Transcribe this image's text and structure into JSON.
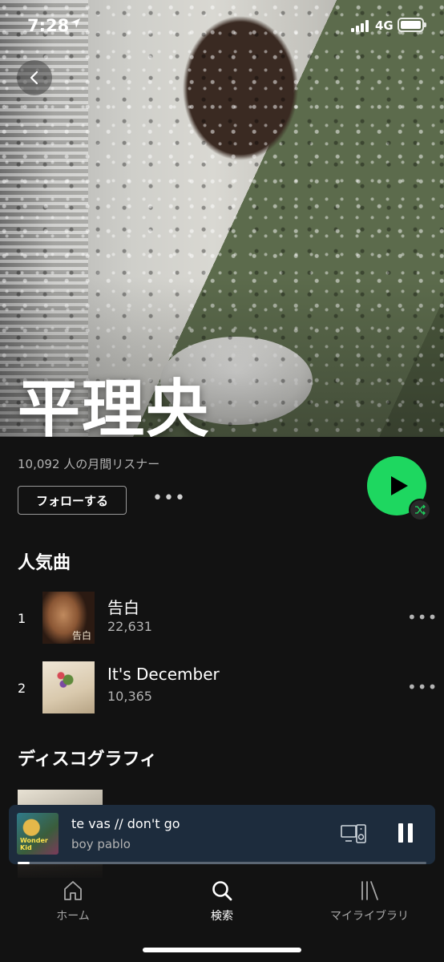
{
  "status_bar": {
    "time": "7:28",
    "network": "4G"
  },
  "artist": {
    "name": "平理央",
    "monthly_listeners": "10,092 人の月間リスナー",
    "follow_label": "フォローする"
  },
  "popular": {
    "title": "人気曲",
    "tracks": [
      {
        "rank": "1",
        "title": "告白",
        "plays": "22,631",
        "art_text": "告白"
      },
      {
        "rank": "2",
        "title": "It's December",
        "plays": "10,365"
      }
    ]
  },
  "discography": {
    "title": "ディスコグラフィ"
  },
  "now_playing": {
    "title": "te vas // don't go",
    "artist": "boy pablo",
    "progress": 0.03
  },
  "nav": {
    "home": "ホーム",
    "search": "検索",
    "library": "マイライブラリ",
    "active": "search"
  },
  "colors": {
    "accent": "#1ed760",
    "mini_player_bg": "#1d2c3d",
    "background": "#121212"
  },
  "icons": [
    "back-arrow-icon",
    "location-arrow-icon",
    "signal-icon",
    "battery-icon",
    "play-icon",
    "shuffle-icon",
    "more-icon",
    "device-icon",
    "pause-icon",
    "home-icon",
    "search-icon",
    "library-icon"
  ]
}
